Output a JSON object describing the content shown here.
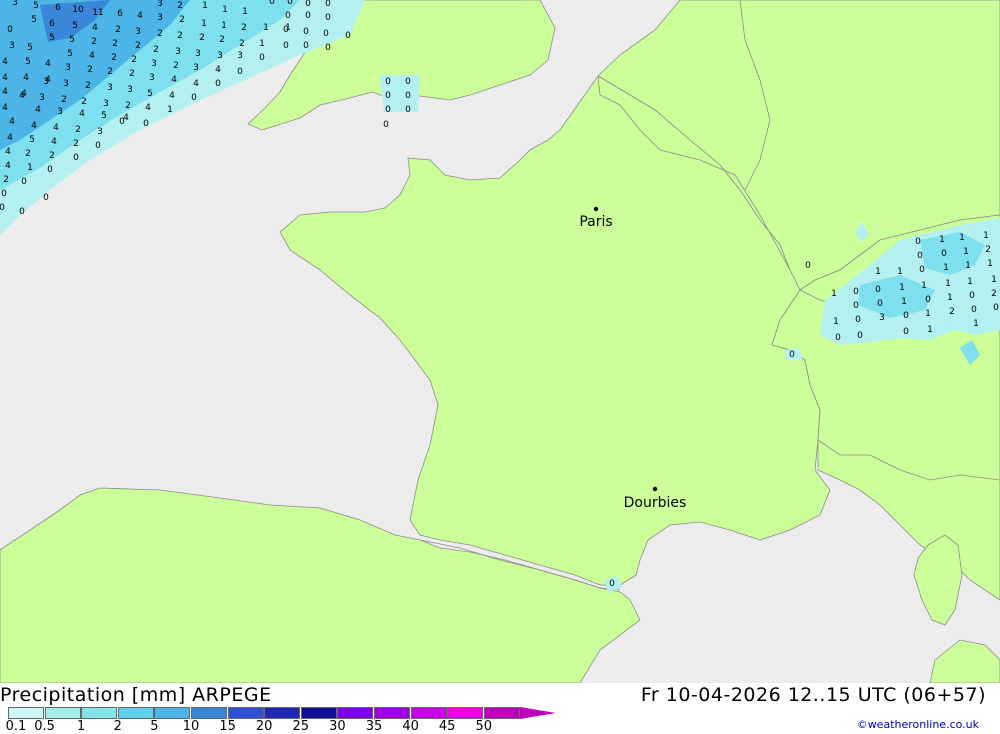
{
  "map": {
    "cities": [
      {
        "name": "Paris"
      },
      {
        "name": "Dourbies"
      }
    ],
    "colors": {
      "sea": "#ececec",
      "land": "#ccff99",
      "border": "#8c8c8c",
      "precip_light": "#b4f0f0",
      "precip_mid": "#7ee0ee",
      "precip_heavy": "#4cb4e6",
      "precip_max": "#3a86d8"
    }
  },
  "footer": {
    "title": "Precipitation [mm] ARPEGE",
    "datetime": "Fr 10-04-2026 12..15 UTC (06+57)",
    "credit": "©weatheronline.co.uk"
  },
  "legend": {
    "labels": [
      "0.1",
      "0.5",
      "1",
      "2",
      "5",
      "10",
      "15",
      "20",
      "25",
      "30",
      "35",
      "40",
      "45",
      "50"
    ],
    "colors": [
      "#ccf8f8",
      "#a6eeee",
      "#82e4ea",
      "#60d2ec",
      "#4cb4e6",
      "#3a86d8",
      "#3050d6",
      "#1e28b4",
      "#101096",
      "#7a00e6",
      "#a000e6",
      "#c800e6",
      "#e600e6",
      "#be00be"
    ]
  }
}
